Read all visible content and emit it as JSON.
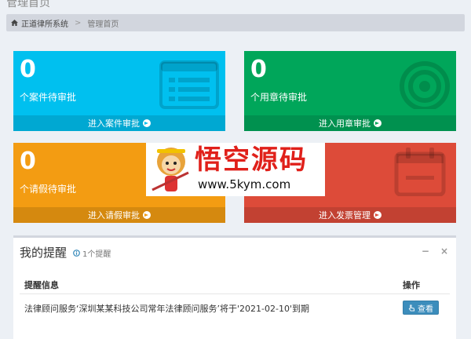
{
  "page": {
    "title": "管理首页"
  },
  "breadcrumb": {
    "home": "正道律所系统",
    "separator": ">",
    "current": "管理首页"
  },
  "boxes": [
    {
      "count": "0",
      "label": "个案件待审批",
      "link": "进入案件审批",
      "color": "#00c0ef",
      "icon": "list-icon"
    },
    {
      "count": "0",
      "label": "个用章待审批",
      "link": "进入用章审批",
      "color": "#00a65a",
      "icon": "target-icon"
    },
    {
      "count": "0",
      "label": "个请假待审批",
      "link": "进入请假审批",
      "color": "#f39c12",
      "icon": "none"
    },
    {
      "count": "0",
      "label": "",
      "link": "进入发票管理",
      "color": "#dd4b39",
      "icon": "calendar-icon"
    }
  ],
  "watermark": {
    "title": "悟空源码",
    "url": "www.5kym.com"
  },
  "reminders": {
    "title": "我的提醒",
    "count_text": "1个提醒",
    "collapse": "−",
    "close": "×",
    "columns": [
      "提醒信息",
      "操作"
    ],
    "rows": [
      {
        "message": "法律顾问服务‘深圳某某科技公司常年法律顾问服务’将于'2021-02-10'到期",
        "action": "查看"
      }
    ]
  }
}
